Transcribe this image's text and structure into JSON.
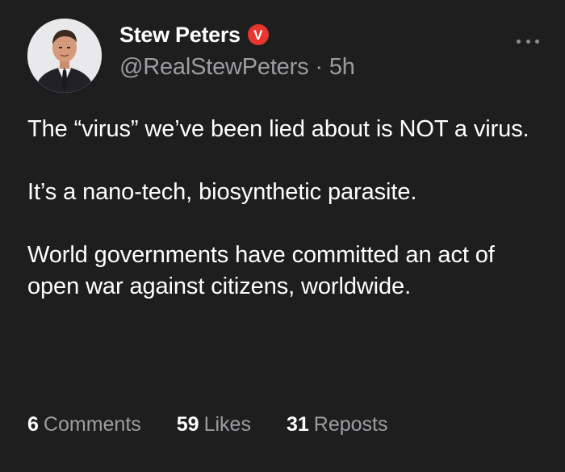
{
  "author": {
    "display_name": "Stew Peters",
    "badge_letter": "V",
    "handle": "@RealStewPeters",
    "separator": "·",
    "time_ago": "5h"
  },
  "post": {
    "paragraphs": [
      "The “virus” we’ve been lied about is NOT a virus.",
      "It’s a nano-tech, biosynthetic parasite.",
      "World governments have committed an act of open war against citizens, worldwide."
    ]
  },
  "stats": {
    "comments_count": "6",
    "comments_label": "Comments",
    "likes_count": "59",
    "likes_label": "Likes",
    "reposts_count": "31",
    "reposts_label": "Reposts"
  },
  "colors": {
    "background": "#1f1e1f",
    "text_primary": "#ffffff",
    "text_secondary": "#9c9ca1",
    "badge": "#e8352d"
  },
  "icons": {
    "more": "more-horizontal-icon",
    "badge": "verified-badge-icon"
  }
}
